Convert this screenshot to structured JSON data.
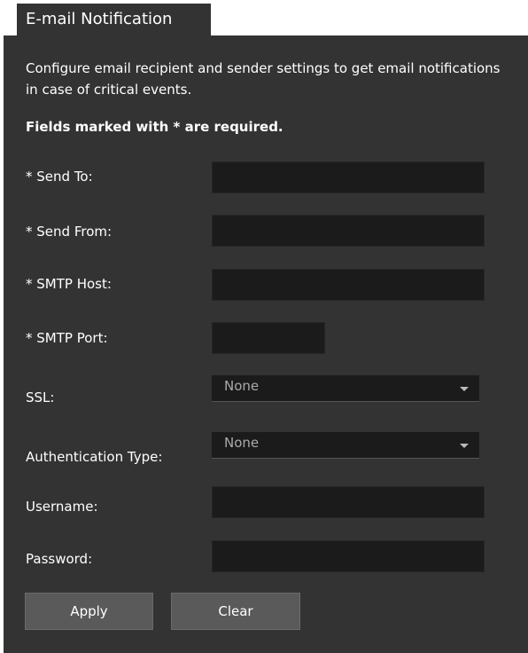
{
  "tab": {
    "title": "E-mail Notification"
  },
  "description": "Configure email recipient and sender settings to get email notifications in case of critical events.",
  "required_note": "Fields marked with * are required.",
  "fields": {
    "send_to": {
      "label": "* Send To:",
      "value": ""
    },
    "send_from": {
      "label": "* Send From:",
      "value": ""
    },
    "smtp_host": {
      "label": "* SMTP Host:",
      "value": ""
    },
    "smtp_port": {
      "label": "* SMTP Port:",
      "value": ""
    },
    "ssl": {
      "label": "SSL:",
      "value": "None"
    },
    "auth_type": {
      "label": "Authentication Type:",
      "value": "None"
    },
    "username": {
      "label": "Username:",
      "value": ""
    },
    "password": {
      "label": "Password:",
      "value": ""
    }
  },
  "buttons": {
    "apply": "Apply",
    "clear": "Clear"
  },
  "icons": {
    "dropdown": "chevron-down-icon"
  },
  "colors": {
    "panel": "#333333",
    "input": "#1b1b1b",
    "button": "#5a5a5a",
    "text": "#ffffff"
  }
}
